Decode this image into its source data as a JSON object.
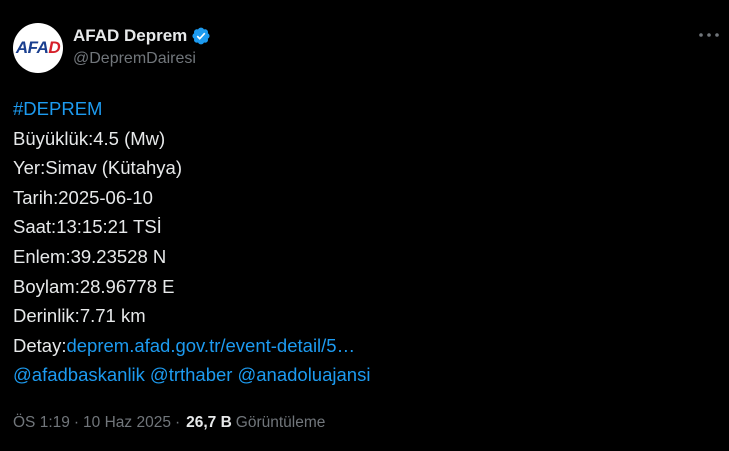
{
  "author": {
    "avatar_text_main": "AFAD",
    "display_name": "AFAD Deprem",
    "handle": "@DepremDairesi"
  },
  "icons": {
    "verified": "verified-badge-icon",
    "more": "more-options-icon"
  },
  "colors": {
    "background": "#000000",
    "text": "#e7e9ea",
    "muted": "#71767b",
    "link": "#1d9bf0"
  },
  "tweet": {
    "hashtag": "#DEPREM",
    "magnitude": "Büyüklük:4.5 (Mw)",
    "location": "Yer:Simav (Kütahya)",
    "date": "Tarih:2025-06-10",
    "time": "Saat:13:15:21 TSİ",
    "latitude": "Enlem:39.23528 N",
    "longitude": "Boylam:28.96778 E",
    "depth": "Derinlik:7.71 km",
    "detail_label": "Detay:",
    "detail_link": "deprem.afad.gov.tr/event-detail/5…",
    "mentions": [
      "@afadbaskanlik",
      "@trthaber",
      "@anadoluajansi"
    ]
  },
  "meta": {
    "time": "ÖS 1:19",
    "separator": "·",
    "date": "10 Haz 2025",
    "views_count": "26,7 B",
    "views_label": "Görüntüleme"
  }
}
